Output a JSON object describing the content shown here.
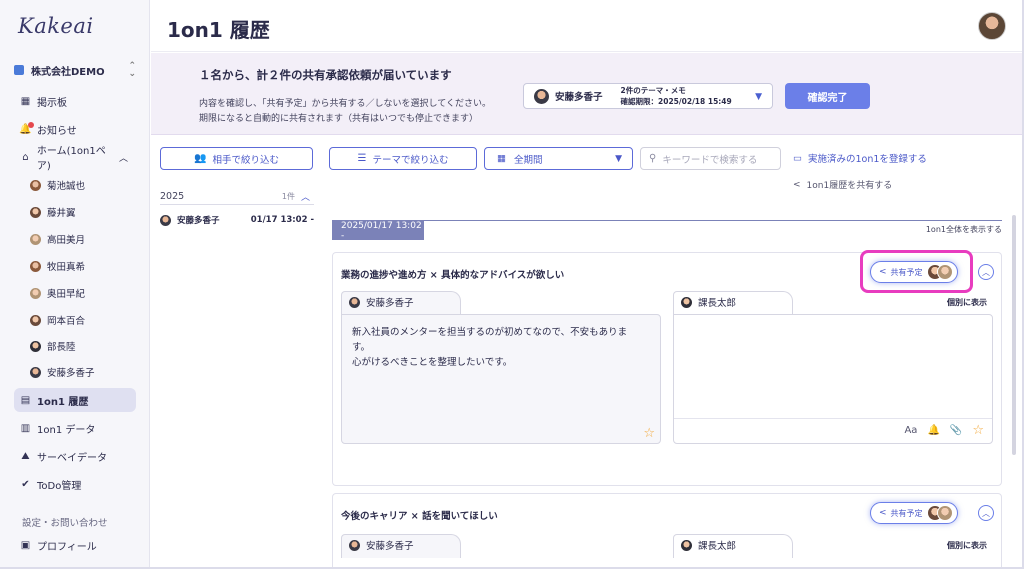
{
  "app": {
    "logo": "Kakeai"
  },
  "sidebar": {
    "company": "株式会社DEMO",
    "items": [
      {
        "label": "掲示板",
        "icon": "board-icon"
      },
      {
        "label": "お知らせ",
        "icon": "bell-icon"
      },
      {
        "label": "ホーム(1on1ペア)",
        "icon": "home-icon"
      }
    ],
    "members": [
      "菊池誠也",
      "藤井翼",
      "高田美月",
      "牧田真希",
      "奥田早紀",
      "岡本百合",
      "部長陸",
      "安藤多香子"
    ],
    "lower_items": [
      {
        "label": "1on1 履歴",
        "icon": "history-icon",
        "active": true
      },
      {
        "label": "1on1 データ",
        "icon": "chart-icon"
      },
      {
        "label": "サーベイデータ",
        "icon": "survey-icon"
      },
      {
        "label": "ToDo管理",
        "icon": "check-circle-icon"
      }
    ],
    "settings_label": "設定・お問い合わせ",
    "profile_label": "プロフィール"
  },
  "header": {
    "title": "1on1 履歴"
  },
  "banner": {
    "title": "１名から、計２件の共有承認依頼が届いています",
    "desc1": "内容を確認し、「共有予定」から共有する／しないを選択してください。",
    "desc2": "期限になると自動的に共有されます（共有はいつでも停止できます）",
    "select": {
      "name": "安藤多香子",
      "count": "2件のテーマ・メモ",
      "deadline": "確認期限：2025/02/18 15:49"
    },
    "confirm_button": "確認完了"
  },
  "toolbar": {
    "filter_partner": "相手で絞り込む",
    "filter_theme": "テーマで絞り込む",
    "period": "全期間",
    "search_placeholder": "キーワードで検索する",
    "register_link": "実施済みの1on1を登録する",
    "share_history_link": "1on1履歴を共有する"
  },
  "history_list": {
    "year": "2025",
    "count": "1件",
    "rows": [
      {
        "name": "安藤多香子",
        "datetime": "01/17 13:02 -"
      }
    ]
  },
  "session": {
    "date_label": "2025/01/17 13:02 -",
    "show_all_link": "1on1全体を表示する",
    "cards": [
      {
        "title": "業務の進捗や進め方 × 具体的なアドバイスが欲しい",
        "share_label": "共有予定",
        "left_author": "安藤多香子",
        "left_text_1": "新入社員のメンターを担当するのが初めてなので、不安もありま",
        "left_text_2": "す。",
        "left_text_3": "心がけるべきことを整理したいです。",
        "right_author": "課長太郎",
        "individual_label": "個別に表示",
        "tools": [
          "Aa",
          "bell-icon",
          "paperclip-icon",
          "star-icon"
        ]
      },
      {
        "title": "今後のキャリア × 話を聞いてほしい",
        "share_label": "共有予定",
        "left_author": "安藤多香子",
        "right_author": "課長太郎",
        "individual_label": "個別に表示"
      }
    ]
  },
  "colors": {
    "accent": "#5c6ad8",
    "highlight": "#e83cbf",
    "star": "#f3a93b",
    "banner_bg": "#f3eff8"
  }
}
